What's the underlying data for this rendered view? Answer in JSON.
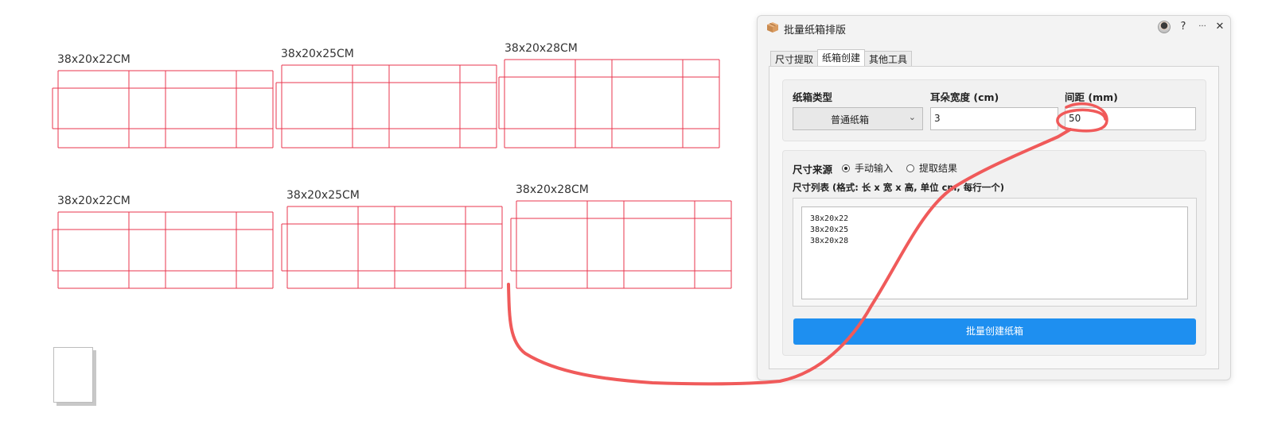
{
  "canvas": {
    "boxes": [
      {
        "label": "38x20x22CM"
      },
      {
        "label": "38x20x25CM"
      },
      {
        "label": "38x20x28CM"
      },
      {
        "label": "38x20x22CM"
      },
      {
        "label": "38x20x25CM"
      },
      {
        "label": "38x20x28CM"
      }
    ],
    "line_color": "#e8364e"
  },
  "panel": {
    "title": "批量纸箱排版",
    "titlebar_buttons": {
      "help": "?",
      "more": "···",
      "close": "✕"
    },
    "tabs": [
      {
        "label": "尺寸提取",
        "active": false
      },
      {
        "label": "纸箱创建",
        "active": true
      },
      {
        "label": "其他工具",
        "active": false
      }
    ],
    "box_type_label": "纸箱类型",
    "box_type_value": "普通纸箱",
    "ear_width_label": "耳朵宽度 (cm)",
    "ear_width_value": "3",
    "spacing_label": "间距 (mm)",
    "spacing_value": "50",
    "size_source_label": "尺寸来源",
    "radio_manual": "手动输入",
    "radio_extract": "提取结果",
    "radio_selected": "manual",
    "size_list_label": "尺寸列表 (格式: 长 x 宽 x 高, 单位 cm, 每行一个)",
    "size_list": [
      "38x20x22",
      "38x20x25",
      "38x20x28"
    ],
    "create_button": "批量创建纸箱",
    "accent_color": "#1e8ff0"
  },
  "annotation": {
    "color": "#f05a5a"
  }
}
